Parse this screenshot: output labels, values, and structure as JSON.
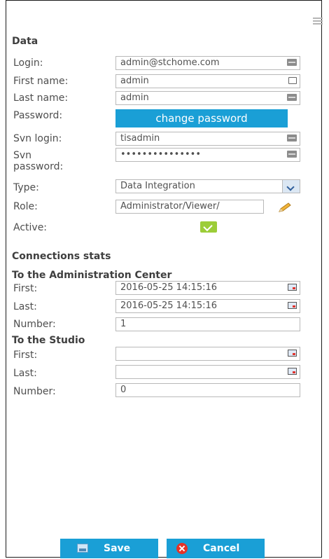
{
  "data_section": {
    "title": "Data",
    "login": {
      "label": "Login:",
      "value": "admin@stchome.com"
    },
    "first_name": {
      "label": "First name:",
      "value": "admin"
    },
    "last_name": {
      "label": "Last name:",
      "value": "admin"
    },
    "password": {
      "label": "Password:",
      "button": "change password"
    },
    "svn_login": {
      "label": "Svn login:",
      "value": "tisadmin"
    },
    "svn_password": {
      "label_line1": "Svn",
      "label_line2": "password:",
      "value": "•••••••••••••••"
    },
    "type": {
      "label": "Type:",
      "value": "Data Integration"
    },
    "role": {
      "label": "Role:",
      "value": "Administrator/Viewer/"
    },
    "active": {
      "label": "Active:",
      "checked": true
    }
  },
  "stats_section": {
    "title": "Connections stats",
    "admin_center": {
      "title": "To the Administration Center",
      "first": {
        "label": "First:",
        "value": "2016-05-25 14:15:16"
      },
      "last": {
        "label": "Last:",
        "value": "2016-05-25 14:15:16"
      },
      "number": {
        "label": "Number:",
        "value": "1"
      }
    },
    "studio": {
      "title": "To the Studio",
      "first": {
        "label": "First:",
        "value": ""
      },
      "last": {
        "label": "Last:",
        "value": ""
      },
      "number": {
        "label": "Number:",
        "value": "0"
      }
    }
  },
  "footer": {
    "save_label": "Save",
    "cancel_label": "Cancel"
  },
  "icons": {
    "menu": "hamburger-icon",
    "field": "keyboard-icon",
    "user": "user-card-icon",
    "calendar": "calendar-icon",
    "edit": "pencil-icon",
    "save": "save-icon",
    "cancel": "cancel-icon"
  },
  "colors": {
    "accent": "#1a9fd6",
    "checkbox": "#9ccd38",
    "cancel_icon": "#e63227"
  }
}
